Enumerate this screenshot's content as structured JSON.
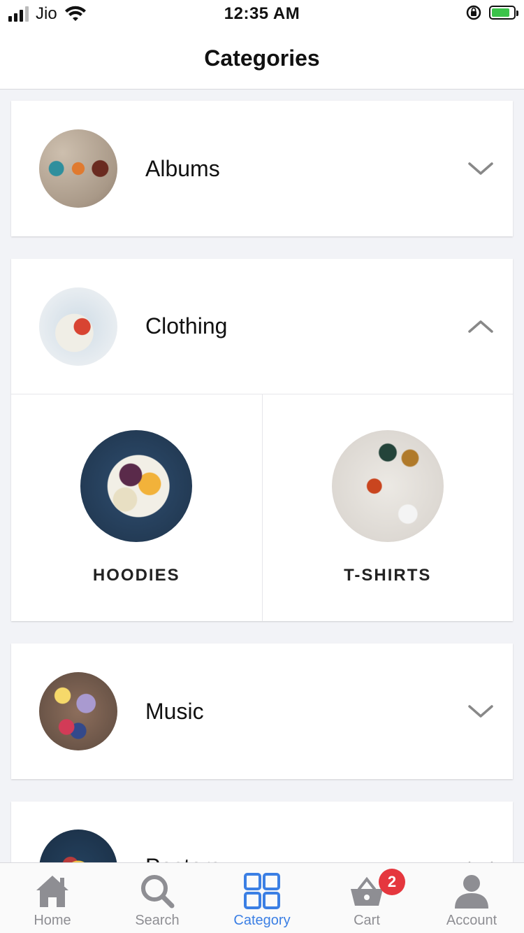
{
  "status_bar": {
    "carrier": "Jio",
    "time": "12:35 AM"
  },
  "header": {
    "title": "Categories"
  },
  "categories": [
    {
      "name": "Albums",
      "expanded": false
    },
    {
      "name": "Clothing",
      "expanded": true,
      "subcategories": [
        "HOODIES",
        "T-SHIRTS"
      ]
    },
    {
      "name": "Music",
      "expanded": false
    },
    {
      "name": "Posters",
      "expanded": false
    }
  ],
  "tabbar": {
    "items": [
      {
        "label": "Home",
        "icon": "home-icon"
      },
      {
        "label": "Search",
        "icon": "search-icon"
      },
      {
        "label": "Category",
        "icon": "category-grid-icon",
        "active": true
      },
      {
        "label": "Cart",
        "icon": "basket-icon",
        "badge": "2"
      },
      {
        "label": "Account",
        "icon": "user-icon"
      }
    ]
  },
  "colors": {
    "active_tab": "#3b7fe4",
    "inactive_tab": "#8e8e93",
    "badge": "#e5373e",
    "battery_fill": "#3bc34a"
  }
}
